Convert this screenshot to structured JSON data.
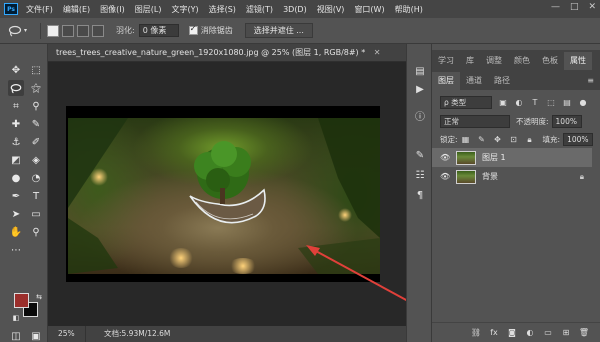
{
  "app": {
    "logo": "Ps"
  },
  "menu": [
    "文件(F)",
    "编辑(E)",
    "图像(I)",
    "图层(L)",
    "文字(Y)",
    "选择(S)",
    "滤镜(T)",
    "3D(D)",
    "视图(V)",
    "窗口(W)",
    "帮助(H)"
  ],
  "window_controls": {
    "minimize": "—",
    "maximize": "□",
    "close": "✕"
  },
  "options": {
    "feather_label": "羽化:",
    "feather_value": "0 像素",
    "antialias_label": "消除锯齿",
    "select_mask_button": "选择并遮住 ..."
  },
  "document": {
    "tab_title": "trees_trees_creative_nature_green_1920x1080.jpg @ 25% (图层 1, RGB/8#) *",
    "tab_close": "✕",
    "zoom": "25%",
    "doc_info": "文档:5.93M/12.6M"
  },
  "colors": {
    "foreground": "#9b2f2c",
    "background": "#0a0a0a",
    "annotation_arrow": "#e0403a"
  },
  "panel_top_tabs": [
    "学习",
    "库",
    "调整",
    "颜色",
    "色板",
    "属性"
  ],
  "layers_panel": {
    "tabs": [
      "图层",
      "通道",
      "路径"
    ],
    "filter_kind": "ρ 类型",
    "blend_mode": "正常",
    "opacity_label": "不透明度:",
    "opacity_value": "100%",
    "lock_label": "锁定:",
    "fill_label": "填充:",
    "fill_value": "100%",
    "layers": [
      {
        "name": "图层 1",
        "selected": true,
        "locked": false
      },
      {
        "name": "背景",
        "selected": false,
        "locked": true
      }
    ]
  },
  "strip_tab_menu": "≡"
}
